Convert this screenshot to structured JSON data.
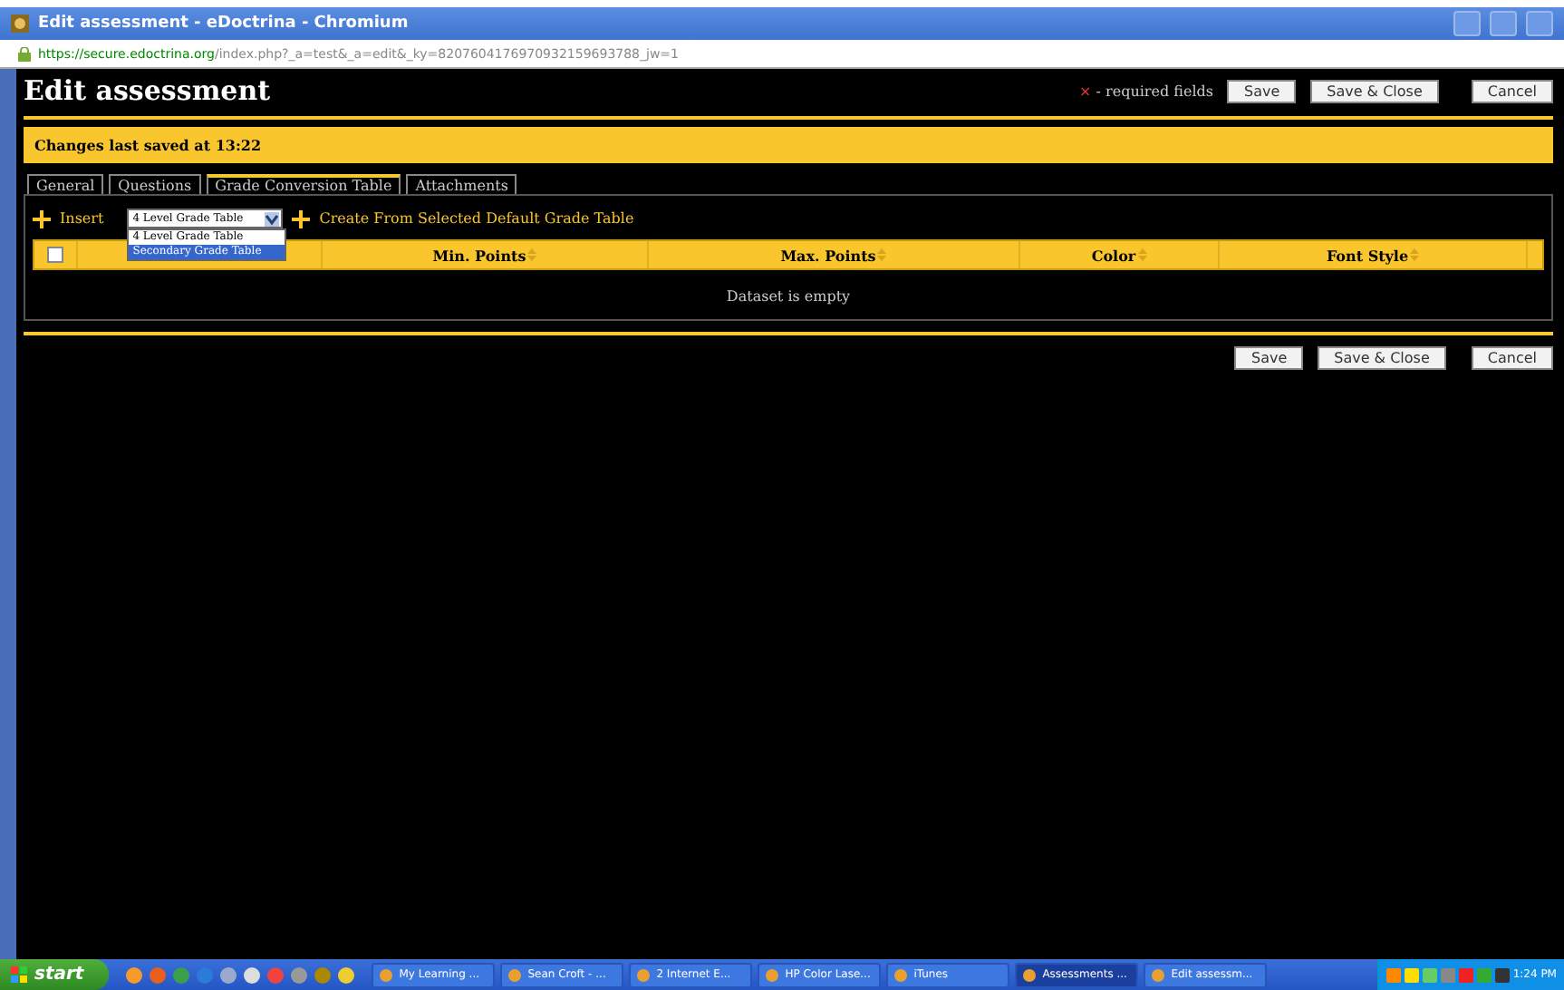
{
  "window": {
    "title": "Edit assessment - eDoctrina - Chromium"
  },
  "address_bar": {
    "host": "https://secure.edoctrina.org",
    "path": "/index.php?_a=test&_a=edit&_ky=8207604176970932159693788_jw=1"
  },
  "header": {
    "title": "Edit assessment",
    "required_mark": "×",
    "required_note": " - required fields",
    "buttons": [
      "Save",
      "Save & Close",
      "Cancel"
    ]
  },
  "notice": "Changes last saved at 13:22",
  "tabs": [
    {
      "label": "General",
      "selected": false
    },
    {
      "label": "Questions",
      "selected": false
    },
    {
      "label": "Grade Conversion Table",
      "selected": true
    },
    {
      "label": "Attachments",
      "selected": false
    }
  ],
  "toolbar": {
    "insert": "Insert",
    "select": {
      "value": "4 Level Grade Table",
      "expanded": true,
      "options": [
        {
          "label": "4 Level Grade Table",
          "highlighted": false
        },
        {
          "label": "Secondary Grade Table",
          "highlighted": true
        }
      ]
    },
    "create": "Create From Selected Default Grade Table"
  },
  "table": {
    "select_all_checked": false,
    "columns": [
      "Min. Points",
      "Max. Points",
      "Color",
      "Font Style"
    ],
    "empty_message": "Dataset is empty"
  },
  "footer_buttons": [
    "Save",
    "Save & Close",
    "Cancel"
  ],
  "taskbar": {
    "start": "start",
    "tasks": [
      {
        "label": "My Learning ...",
        "selected": false
      },
      {
        "label": "Sean Croft - ...",
        "selected": false
      },
      {
        "label": "2 Internet E...",
        "selected": false
      },
      {
        "label": "HP Color Lase...",
        "selected": false
      },
      {
        "label": "iTunes",
        "selected": false
      },
      {
        "label": "Assessments ...",
        "selected": true
      },
      {
        "label": "Edit assessm...",
        "selected": false
      }
    ],
    "clock": "1:24 PM"
  }
}
